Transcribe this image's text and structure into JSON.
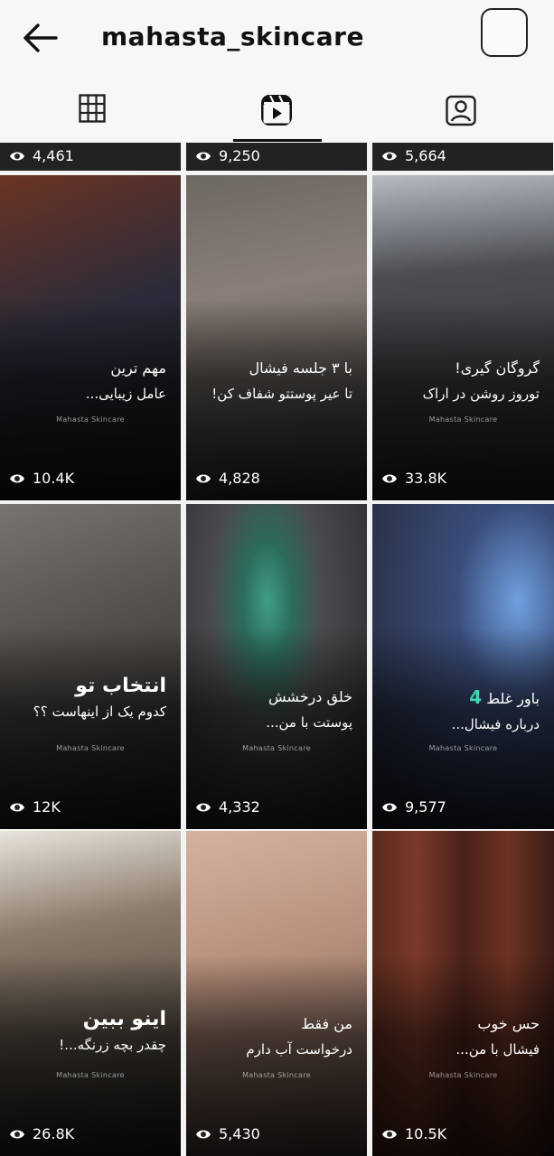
{
  "header": {
    "title": "mahasta_skincare",
    "back_icon": "arrow-left-icon"
  },
  "tabs": [
    {
      "name": "grid",
      "icon": "grid-icon"
    },
    {
      "name": "reels",
      "icon": "reels-icon",
      "active": true
    },
    {
      "name": "tagged",
      "icon": "tagged-user-icon"
    }
  ],
  "partial_row": [
    {
      "views": "4,461"
    },
    {
      "views": "9,250"
    },
    {
      "views": "5,664"
    }
  ],
  "reels": [
    {
      "line1": "مهم ترین",
      "line2": "عامل زیبایی...",
      "brand": "Mahasta Skincare",
      "views": "10.4K",
      "bg": "#3a2a22"
    },
    {
      "line1": "با ۳ جلسه فیشال",
      "line2": "تا عیر پوستتو شفاف کن!",
      "brand": "Mahasta Skincare",
      "views": "4,828",
      "bg": "#5a5550"
    },
    {
      "line1": "گروگان گیری!",
      "line2": "توروز روشن در اراک",
      "brand": "Mahasta Skincare",
      "views": "33.8K",
      "bg": "#2e3032"
    },
    {
      "line1": "انتخاب تو",
      "line2": "کدوم یک از اینهاست ؟؟",
      "brand": "Mahasta Skincare",
      "views": "12K",
      "bg": "#4a4644",
      "big": true
    },
    {
      "line1": "خلق درخشش",
      "line2": "پوستت با من...",
      "brand": "Mahasta Skincare",
      "views": "4,332",
      "bg": "#3d3d40"
    },
    {
      "accent": "4",
      "line1": "باور غلط",
      "line2": "درباره فیشال...",
      "brand": "Mahasta Skincare",
      "views": "9,577",
      "bg": "#262a38"
    },
    {
      "line1": "اینو ببین",
      "line2": "چقدر بچه زرنگه...!",
      "brand": "Mahasta Skincare",
      "views": "26.8K",
      "bg": "#2a2420",
      "big": true
    },
    {
      "line1": "من فقط",
      "line2": "درخواست آب دارم",
      "brand": "Mahasta Skincare",
      "views": "5,430",
      "bg": "#8a6f60"
    },
    {
      "line1": "حس خوب",
      "line2": "فیشال با من...",
      "brand": "Mahasta Skincare",
      "views": "10.5K",
      "bg": "#4a261c"
    }
  ],
  "icons": {
    "views": "eye-icon"
  }
}
